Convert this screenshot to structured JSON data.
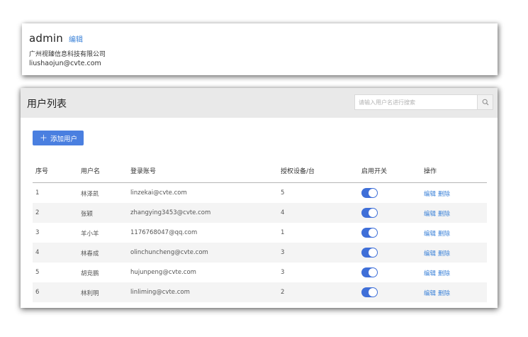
{
  "profile": {
    "name": "admin",
    "edit_label": "编辑",
    "company": "广州视臻信息科技有限公司",
    "email": "liushaojun@cvte.com"
  },
  "user_list": {
    "title": "用户列表",
    "search_placeholder": "请输入用户名进行搜索",
    "search_icon": "search-icon",
    "add_button_label": "添加用户",
    "columns": [
      "序号",
      "用户名",
      "登录账号",
      "授权设备/台",
      "启用开关",
      "操作"
    ],
    "rows": [
      {
        "index": "1",
        "username": "林泽凯",
        "account": "linzekai@cvte.com",
        "devices": "5",
        "enabled": true
      },
      {
        "index": "2",
        "username": "张颖",
        "account": "zhangying3453@cvte.com",
        "devices": "4",
        "enabled": true
      },
      {
        "index": "3",
        "username": "羊小羊",
        "account": "1176768047@qq.com",
        "devices": "1",
        "enabled": true
      },
      {
        "index": "4",
        "username": "林春成",
        "account": "olinchuncheng@cvte.com",
        "devices": "3",
        "enabled": true
      },
      {
        "index": "5",
        "username": "胡竞鹏",
        "account": "hujunpeng@cvte.com",
        "devices": "3",
        "enabled": true
      },
      {
        "index": "6",
        "username": "林利明",
        "account": "linliming@cvte.com",
        "devices": "2",
        "enabled": true
      }
    ],
    "edit_action_label": "编辑",
    "delete_action_label": "删除"
  },
  "colors": {
    "accent": "#4a7fe0",
    "link": "#3b82d8",
    "toggle_on": "#3f6fd8",
    "header_bg": "#e9e9e9"
  }
}
